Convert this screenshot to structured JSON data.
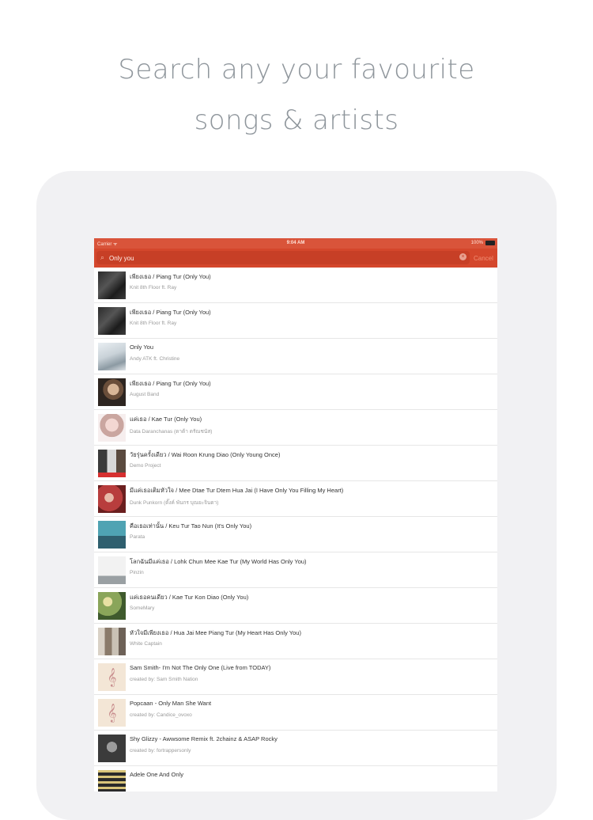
{
  "headline": {
    "line1": "Search any your favourite",
    "line2": "songs & artists"
  },
  "status_bar": {
    "carrier": "Carrier ᯤ",
    "time": "9:04 AM",
    "battery": "100%"
  },
  "search": {
    "query": "Only you",
    "cancel_label": "Cancel"
  },
  "results": [
    {
      "title": "เพียงเธอ / Piang Tur (Only You)",
      "subtitle": "Knit 8th Floor ft. Ray",
      "art": "dark-photo"
    },
    {
      "title": "เพียงเธอ / Piang Tur (Only You)",
      "subtitle": "Knit 8th Floor ft. Ray",
      "art": "dark-photo"
    },
    {
      "title": "Only You",
      "subtitle": "Andy ATK ft. Christine",
      "art": "light-photo"
    },
    {
      "title": "เพียงเธอ / Piang Tur (Only You)",
      "subtitle": "August Band",
      "art": "portrait"
    },
    {
      "title": "แค่เธอ / Kae Tur (Only You)",
      "subtitle": "Data Daranchanas (ดาต้า ดรัณชนัส)",
      "art": "pink-portrait"
    },
    {
      "title": "วัยรุ่นครั้งเดียว / Wai Roon Krung Diao (Only Young Once)",
      "subtitle": "Demo Project",
      "art": "collage"
    },
    {
      "title": "มีแค่เธอเติมหัวใจ / Mee Dtae Tur Dtem Hua Jai (I Have Only You Filling My Heart)",
      "subtitle": "Dunk Punkorn (ดั๊งค์ พันกร บุณยะจินดา)",
      "art": "red-couple"
    },
    {
      "title": "คือเธอเท่านั้น / Keu Tur Tao Nun (It's Only You)",
      "subtitle": "Parata",
      "art": "teal-person"
    },
    {
      "title": "โลกฉันมีแค่เธอ / Lohk Chun Mee Kae Tur (My World Has Only You)",
      "subtitle": "Pinzin",
      "art": "white-figure"
    },
    {
      "title": "แค่เธอคนเดียว / Kae Tur Kon Diao (Only You)",
      "subtitle": "SomeMary",
      "art": "green-flowers"
    },
    {
      "title": "หัวใจมีเพียงเธอ / Hua Jai Mee Piang Tur (My Heart Has Only You)",
      "subtitle": "White Captain",
      "art": "group-photo"
    },
    {
      "title": "Sam Smith- I'm Not The Only One (Live from TODAY)",
      "subtitle": "created by: Sam Smith Nation",
      "art": "music-note"
    },
    {
      "title": "Popcaan - Only Man She Want",
      "subtitle": "created by: Candice_ovoxo",
      "art": "music-note"
    },
    {
      "title": "Shy Glizzy - Awwsome Remix ft. 2chainz & ASAP Rocky",
      "subtitle": "created by: fortrappersonly",
      "art": "bw-photo"
    },
    {
      "title": "Adele One And Only",
      "subtitle": "",
      "art": "stripes"
    }
  ],
  "colors": {
    "accent": "#d4472c",
    "statusbar": "#d9543a",
    "headline": "#8f969c",
    "device": "#f1f1f3"
  }
}
